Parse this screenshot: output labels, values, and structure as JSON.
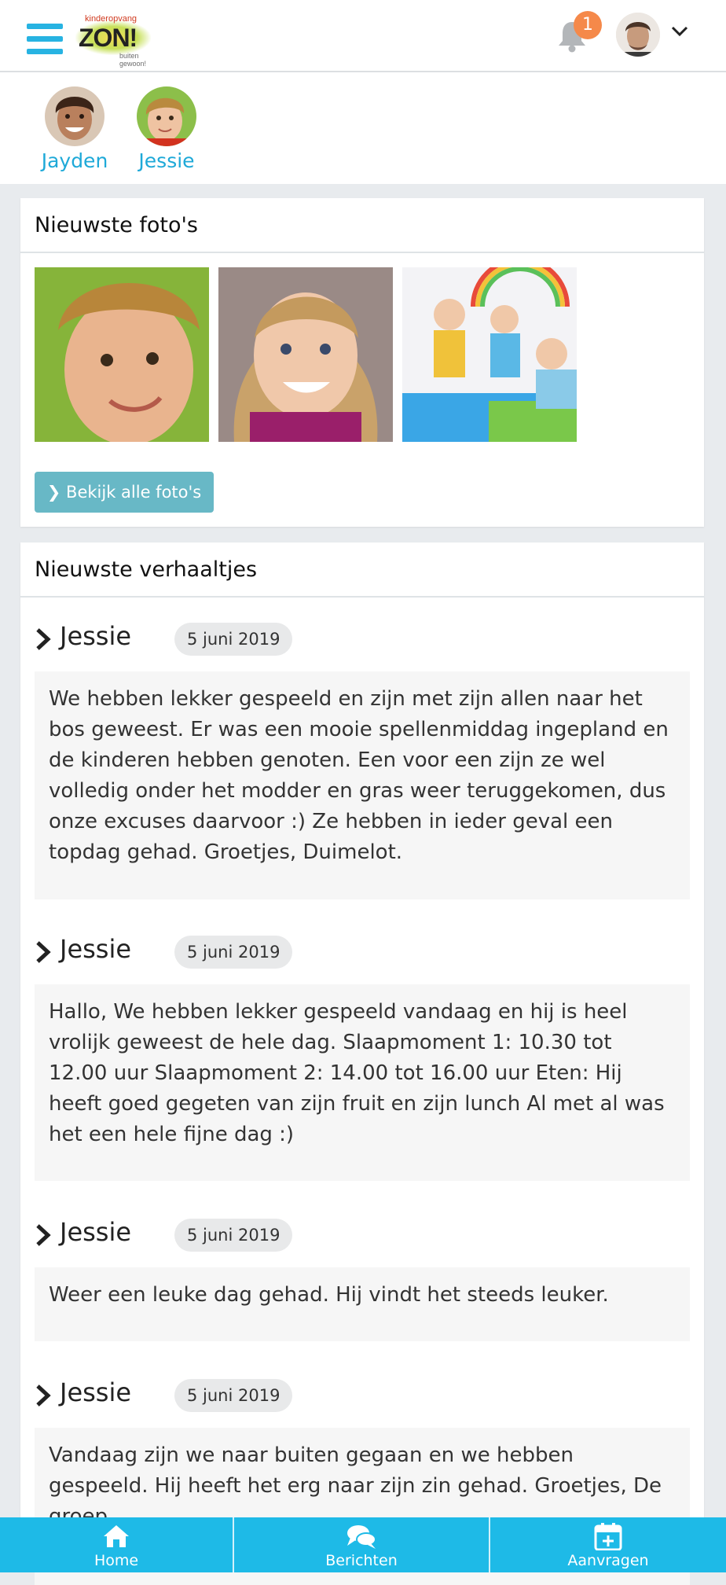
{
  "header": {
    "logo": {
      "line1": "kinderopvang",
      "line2": "ZON!",
      "line3": "buiten gewoon!"
    },
    "notification_count": "1",
    "icons": {
      "menu": "hamburger-menu-icon",
      "bell": "bell-icon",
      "avatar": "user-avatar",
      "dropdown": "chevron-down-icon"
    }
  },
  "children": [
    {
      "name": "Jayden"
    },
    {
      "name": "Jessie"
    }
  ],
  "photos_card": {
    "title": "Nieuwste foto's",
    "button_label": "Bekijk alle foto's"
  },
  "stories_card": {
    "title": "Nieuwste verhaaltjes",
    "stories": [
      {
        "name": "Jessie",
        "date": "5 juni 2019",
        "text": "We hebben lekker gespeeld en zijn met zijn allen naar het bos geweest. Er was een mooie spellenmiddag ingepland en de kinderen hebben genoten. Een voor een zijn ze wel volledig onder het modder en gras weer teruggekomen, dus onze excuses daarvoor :) Ze hebben in ieder geval een topdag gehad. Groetjes, Duimelot."
      },
      {
        "name": "Jessie",
        "date": "5 juni 2019",
        "text": "Hallo, We hebben lekker gespeeld vandaag en hij is heel vrolijk geweest de hele dag. Slaapmoment 1: 10.30 tot 12.00 uur Slaapmoment 2: 14.00 tot 16.00 uur Eten: Hij heeft goed gegeten van zijn fruit en zijn lunch Al met al was het een hele fijne dag :)"
      },
      {
        "name": "Jessie",
        "date": "5 juni 2019",
        "text": "Weer een leuke dag gehad. Hij vindt het steeds leuker."
      },
      {
        "name": "Jessie",
        "date": "5 juni 2019",
        "text": "Vandaag zijn we naar buiten gegaan en we hebben gespeeld. Hij heeft het erg naar zijn zin gehad. Groetjes, De groep"
      }
    ]
  },
  "bottom_nav": [
    {
      "label": "Home",
      "icon": "home-icon"
    },
    {
      "label": "Berichten",
      "icon": "chat-icon"
    },
    {
      "label": "Aanvragen",
      "icon": "calendar-plus-icon"
    }
  ],
  "colors": {
    "accent": "#1ebae7",
    "button": "#68b8c6",
    "badge": "#f5894a",
    "child_name": "#1ea9d8"
  }
}
